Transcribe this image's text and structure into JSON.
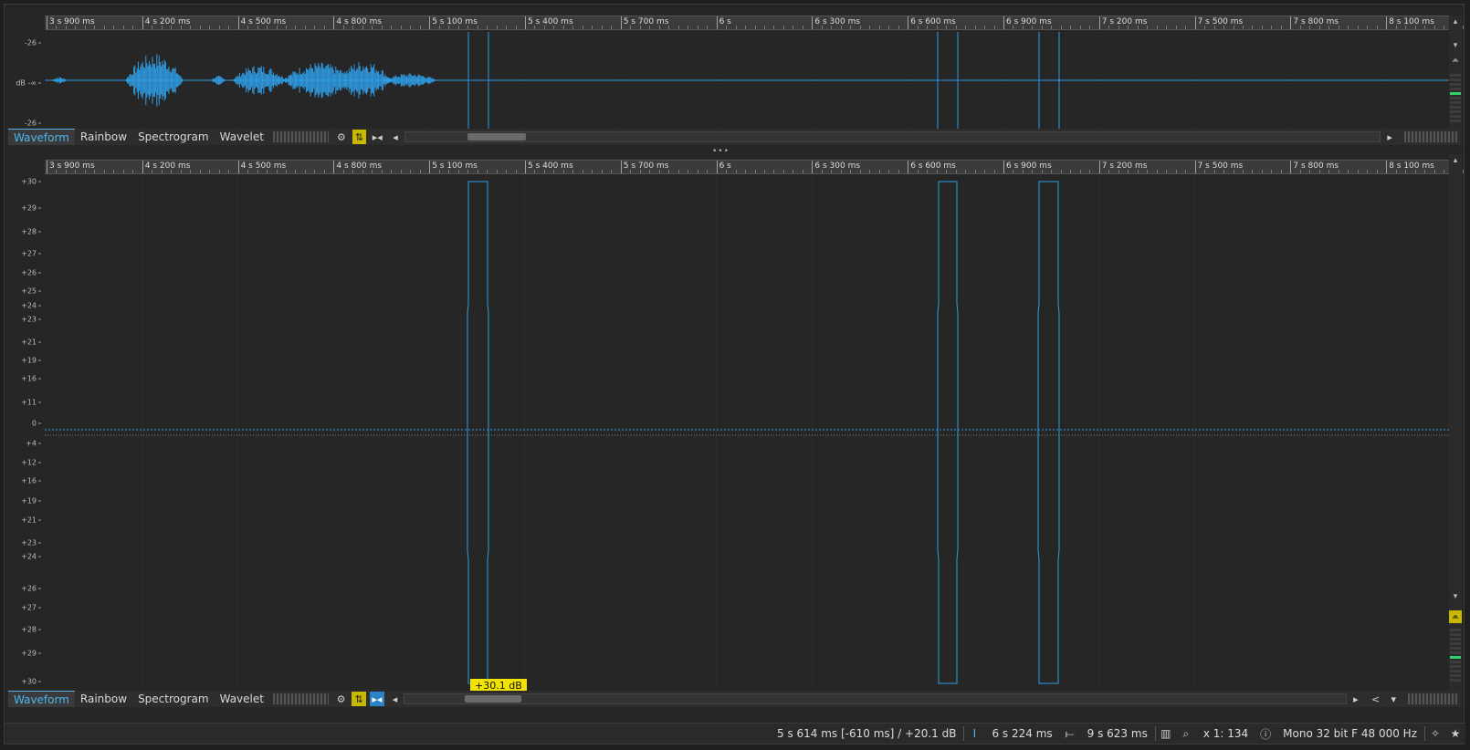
{
  "colors": {
    "wave": "#2f9fe8",
    "accent": "#4fb4f0",
    "tooltip": "#f2e300",
    "toggle": "#c9b800"
  },
  "ruler": {
    "labels": [
      "3 s 900 ms",
      "4 s 200 ms",
      "4 s 500 ms",
      "4 s 800 ms",
      "5 s 100 ms",
      "5 s 400 ms",
      "5 s 700 ms",
      "6 s",
      "6 s 300 ms",
      "6 s 600 ms",
      "6 s 900 ms",
      "7 s 200 ms",
      "7 s 500 ms",
      "7 s 800 ms",
      "8 s 100 ms"
    ]
  },
  "overview": {
    "y_labels": [
      "-26",
      "dB -∞",
      "-26"
    ],
    "tabs": [
      "Waveform",
      "Rainbow",
      "Spectrogram",
      "Wavelet"
    ],
    "active_tab": "Waveform"
  },
  "main": {
    "y_labels": [
      "+30",
      "+29",
      "+28",
      "+27",
      "+26",
      "+25",
      "+24",
      "+23",
      "+21",
      "+19",
      "+16",
      "+11",
      "0",
      "+4",
      "+12",
      "+16",
      "+19",
      "+21",
      "+23",
      "+24",
      "+26",
      "+27",
      "+28",
      "+29",
      "+30"
    ],
    "tabs": [
      "Waveform",
      "Rainbow",
      "Spectrogram",
      "Wavelet"
    ],
    "active_tab": "Waveform"
  },
  "tooltip": {
    "text": "+30.1 dB"
  },
  "splitter": {
    "glyph": "•••"
  },
  "status": {
    "cursor": "5 s 614 ms [-610 ms] / +20.1 dB",
    "selection_start": "6 s 224 ms",
    "selection_end": "9 s 623 ms",
    "zoom": "x 1: 134",
    "format": "Mono 32 bit F 48 000 Hz"
  },
  "icons": {
    "gear": "⚙",
    "toggle": "⇅",
    "play_region": "▸◂",
    "left_arrow": "◂",
    "right_arrow": "▸",
    "up_arrow": "▴",
    "down_arrow": "▾",
    "peak": "⩕",
    "share": "<",
    "caret": "▾",
    "cursor_marker": "I",
    "ruler_icon": "⟝",
    "meter_icon": "▥",
    "search": "⌕",
    "info": "ⓘ",
    "wand": "✧",
    "star": "★"
  }
}
